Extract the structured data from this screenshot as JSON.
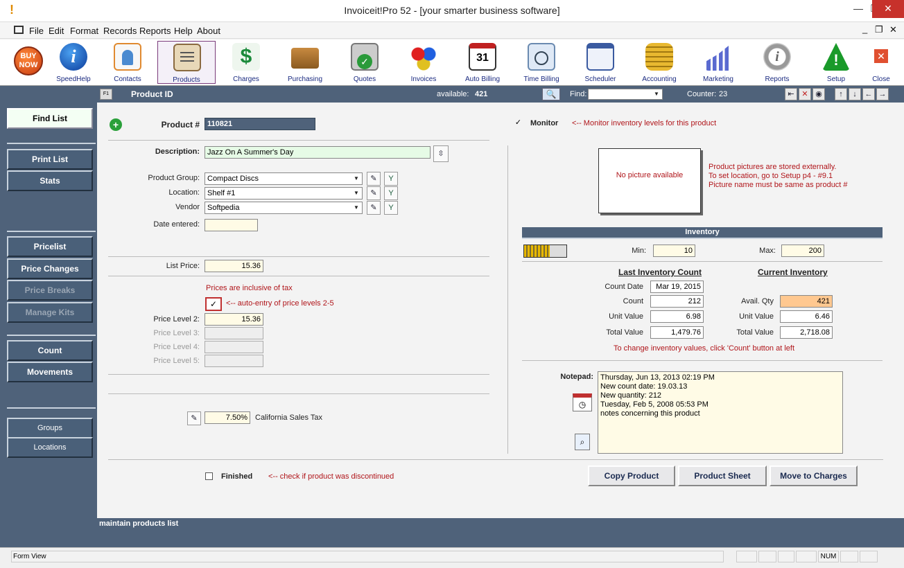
{
  "window": {
    "title": "Invoiceit!Pro 52 - [your smarter business software]",
    "min": "—",
    "restore": "❐",
    "close": "✕"
  },
  "menu": [
    "File",
    "Edit",
    "Format",
    "Records",
    "Reports",
    "Help",
    "About"
  ],
  "mdi_controls": [
    "_",
    "❐",
    "✕"
  ],
  "toolbar": [
    {
      "label": "",
      "icon": "buy-now-icon"
    },
    {
      "label": "SpeedHelp",
      "icon": "info-icon"
    },
    {
      "label": "Contacts",
      "icon": "contacts-icon"
    },
    {
      "label": "Products",
      "icon": "products-icon"
    },
    {
      "label": "Charges",
      "icon": "charges-icon"
    },
    {
      "label": "Purchasing",
      "icon": "truck-icon"
    },
    {
      "label": "Quotes",
      "icon": "calculator-icon"
    },
    {
      "label": "Invoices",
      "icon": "gears-icon"
    },
    {
      "label": "Auto Billing",
      "icon": "calendar-icon"
    },
    {
      "label": "Time Billing",
      "icon": "clock-icon"
    },
    {
      "label": "Scheduler",
      "icon": "scheduler-icon"
    },
    {
      "label": "Accounting",
      "icon": "coins-icon"
    },
    {
      "label": "Marketing",
      "icon": "bar-chart-icon"
    },
    {
      "label": "Reports",
      "icon": "reports-icon"
    },
    {
      "label": "Setup",
      "icon": "warning-icon"
    },
    {
      "label": "Close",
      "icon": "close-icon"
    }
  ],
  "buy_now": {
    "line1": "BUY",
    "line2": "NOW"
  },
  "header": {
    "f1": "F1",
    "title": "Product ID",
    "available_label": "available:",
    "available_value": "421",
    "find_label": "Find:",
    "find_value": "",
    "counter_label": "Counter:",
    "counter_value": "23"
  },
  "header_nav": [
    "↑",
    "↓",
    "←",
    "→"
  ],
  "sidebar": {
    "find_list": "Find List",
    "print_list": "Print List",
    "stats": "Stats",
    "pricelist": "Pricelist",
    "price_changes": "Price Changes",
    "price_breaks": "Price Breaks",
    "manage_kits": "Manage Kits",
    "count": "Count",
    "movements": "Movements",
    "groups": "Groups",
    "locations": "Locations"
  },
  "form": {
    "product_label": "Product #",
    "product_value": "110821",
    "monitor_label": "Monitor",
    "monitor_note": "<-- Monitor inventory levels for this product",
    "description_label": "Description:",
    "description_value": "Jazz On A Summer's Day",
    "group_label": "Product Group:",
    "group_value": "Compact Discs",
    "location_label": "Location:",
    "location_value": "Shelf #1",
    "vendor_label": "Vendor",
    "vendor_value": "Softpedia",
    "date_label": "Date entered:",
    "date_value": "",
    "list_price_label": "List Price:",
    "list_price_value": "15.36",
    "tax_note": "Prices are inclusive of tax",
    "auto_entry_note": "<-- auto-entry of price levels 2-5",
    "pl2_label": "Price Level 2:",
    "pl2_value": "15.36",
    "pl3_label": "Price Level 3:",
    "pl4_label": "Price Level 4:",
    "pl5_label": "Price Level 5:",
    "tax_rate": "7.50%",
    "tax_name": "California Sales Tax",
    "finished_label": "Finished",
    "finished_note": "<-- check if product was discontinued"
  },
  "picture": {
    "box_text": "No picture available",
    "note1": "Product pictures are stored externally.",
    "note2": "To set location, go to Setup p4 - #9.1",
    "note3": "Picture name must be same as product #"
  },
  "inventory": {
    "title": "Inventory",
    "min_label": "Min:",
    "min_value": "10",
    "max_label": "Max:",
    "max_value": "200",
    "last_title": "Last Inventory Count",
    "current_title": "Current Inventory",
    "count_date_label": "Count Date",
    "count_date_value": "Mar 19, 2015",
    "count_label": "Count",
    "count_value": "212",
    "unit_value_label": "Unit Value",
    "unit_value_value": "6.98",
    "total_value_label": "Total Value",
    "total_value_value": "1,479.76",
    "avail_label": "Avail. Qty",
    "avail_value": "421",
    "cur_unit_label": "Unit Value",
    "cur_unit_value": "6.46",
    "cur_total_label": "Total Value",
    "cur_total_value": "2,718.08",
    "change_note": "To change inventory values, click 'Count' button at left",
    "level_fraction": 0.6
  },
  "notepad": {
    "label": "Notepad:",
    "lines": [
      "Thursday, Jun 13, 2013   02:19 PM",
      "New count date: 19.03.13",
      "New quantity: 212",
      "Tuesday, Feb 5, 2008   05:53 PM",
      "notes concerning this product"
    ]
  },
  "buttons": {
    "copy": "Copy Product",
    "sheet": "Product Sheet",
    "move": "Move to Charges"
  },
  "bottom_text": "maintain products list",
  "status": {
    "left": "Form View",
    "num": "NUM"
  },
  "colors": {
    "nav": "#4f627a",
    "field": "#fffbe6",
    "highlight": "#ffc890",
    "note_red": "#b0151a"
  }
}
